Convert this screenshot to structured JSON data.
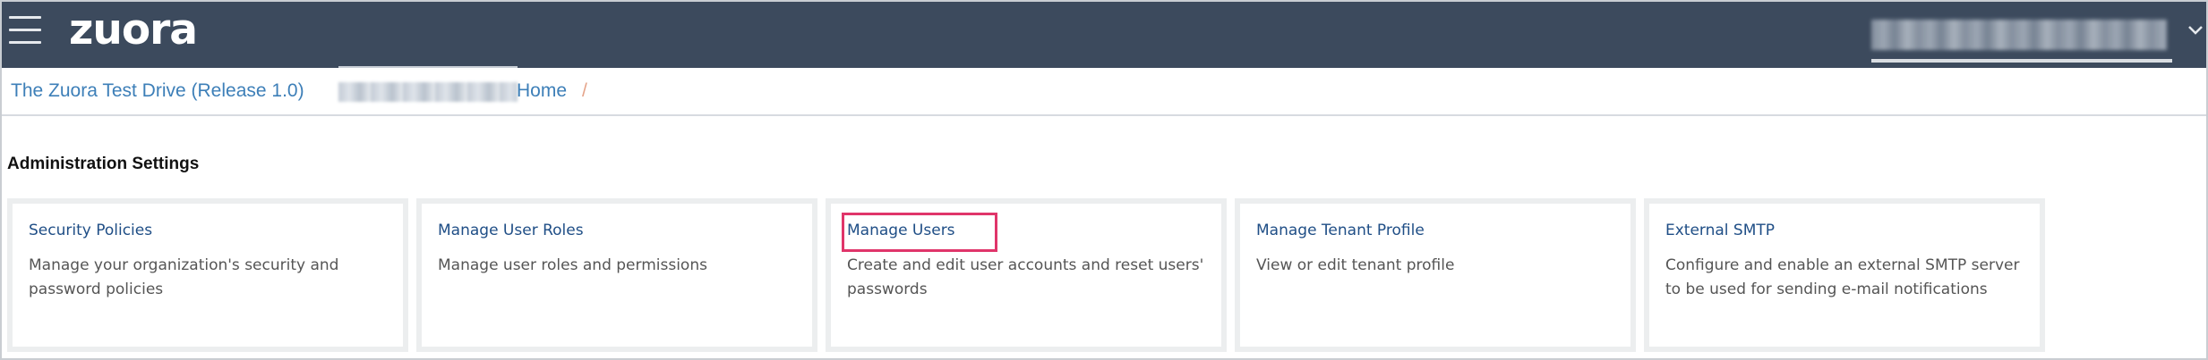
{
  "header": {
    "logo_text": "zuora",
    "background_color": "#3c4a5d",
    "menu_icon": "hamburger-menu-icon",
    "user_menu_icon": "chevron-down-icon"
  },
  "breadcrumb": {
    "tenant": "The Zuora Test Drive (Release 1.0)",
    "home": "Home",
    "separator": "/",
    "link_color": "#3d7fb8"
  },
  "page": {
    "section_title": "Administration Settings"
  },
  "cards": [
    {
      "title": "Security Policies",
      "description": "Manage your organization's security and password policies",
      "highlighted": false
    },
    {
      "title": "Manage User Roles",
      "description": "Manage user roles and permissions",
      "highlighted": false
    },
    {
      "title": "Manage Users",
      "description": "Create and edit user accounts and reset users' passwords",
      "highlighted": true
    },
    {
      "title": "Manage Tenant Profile",
      "description": "View or edit tenant profile",
      "highlighted": false
    },
    {
      "title": "External SMTP",
      "description": "Configure and enable an external SMTP server to be used for sending e-mail notifications",
      "highlighted": false
    }
  ],
  "colors": {
    "card_title": "#1f4e86",
    "highlight_border": "#e0356a"
  }
}
